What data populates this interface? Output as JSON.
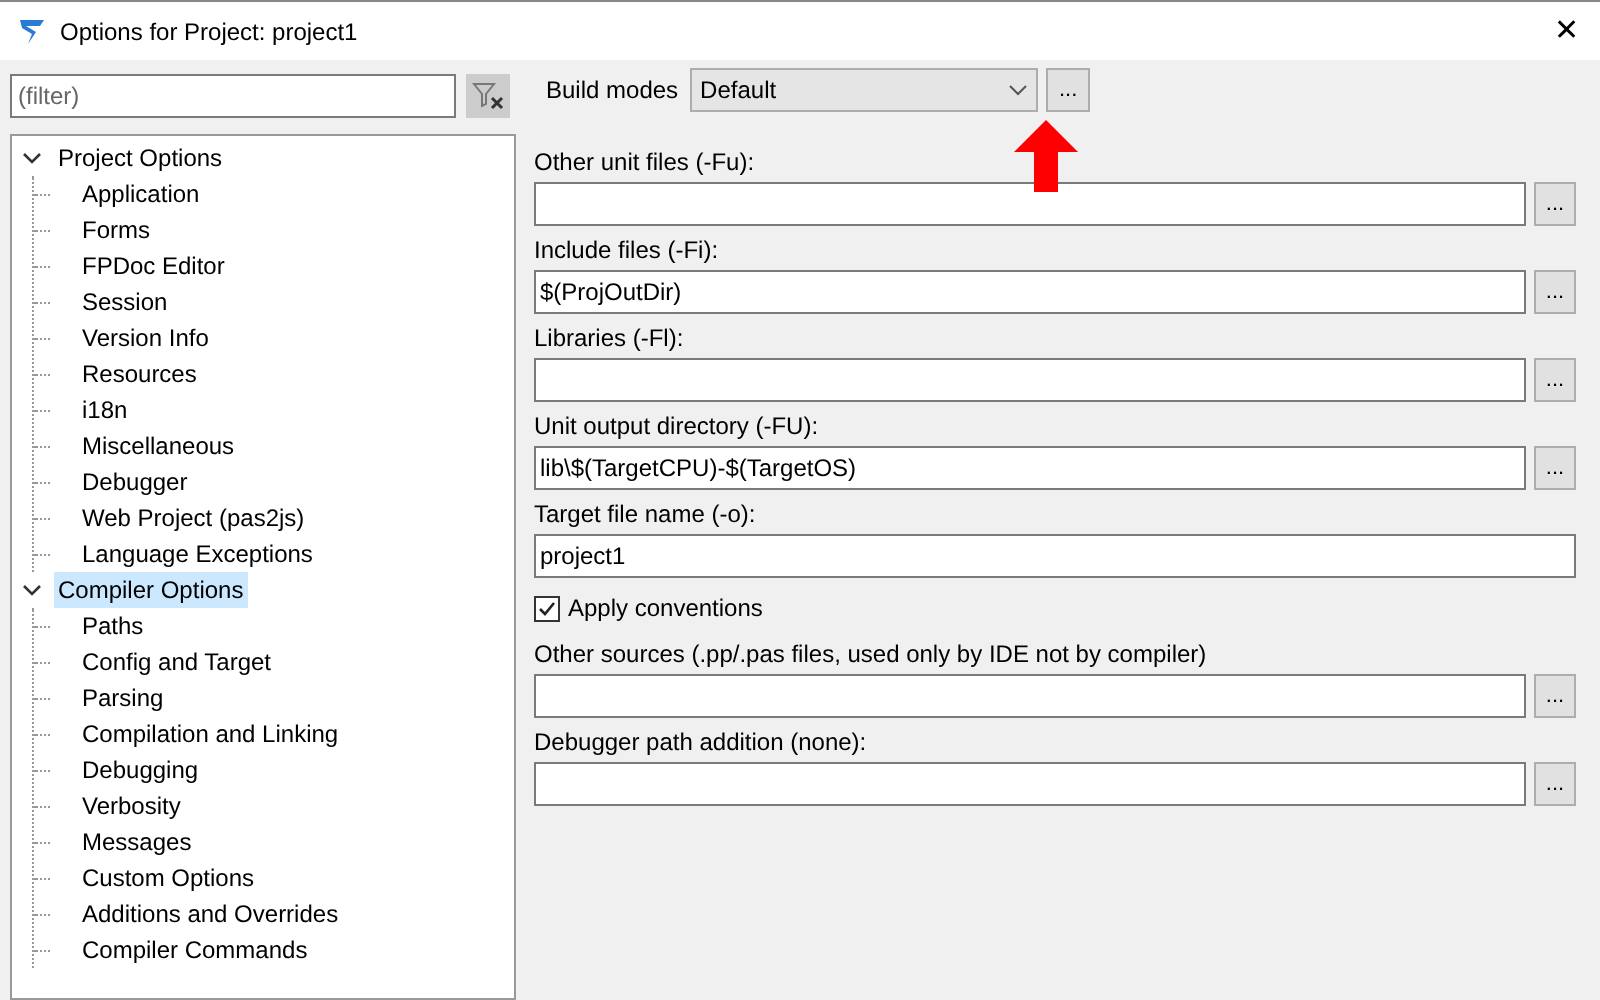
{
  "window": {
    "title": "Options for Project: project1",
    "close": "✕"
  },
  "filter": {
    "placeholder": "(filter)"
  },
  "tree": [
    {
      "label": "Project Options",
      "selected": false,
      "expanded": true,
      "children": [
        {
          "label": "Application",
          "selected": false
        },
        {
          "label": "Forms",
          "selected": false
        },
        {
          "label": "FPDoc Editor",
          "selected": false
        },
        {
          "label": "Session",
          "selected": false
        },
        {
          "label": "Version Info",
          "selected": false
        },
        {
          "label": "Resources",
          "selected": false
        },
        {
          "label": "i18n",
          "selected": false
        },
        {
          "label": "Miscellaneous",
          "selected": false
        },
        {
          "label": "Debugger",
          "selected": false
        },
        {
          "label": "Web Project (pas2js)",
          "selected": false
        },
        {
          "label": "Language Exceptions",
          "selected": false
        }
      ]
    },
    {
      "label": "Compiler Options",
      "selected": true,
      "expanded": true,
      "children": [
        {
          "label": "Paths",
          "selected": false
        },
        {
          "label": "Config and Target",
          "selected": false
        },
        {
          "label": "Parsing",
          "selected": false
        },
        {
          "label": "Compilation and Linking",
          "selected": false
        },
        {
          "label": "Debugging",
          "selected": false
        },
        {
          "label": "Verbosity",
          "selected": false
        },
        {
          "label": "Messages",
          "selected": false
        },
        {
          "label": "Custom Options",
          "selected": false
        },
        {
          "label": "Additions and Overrides",
          "selected": false
        },
        {
          "label": "Compiler Commands",
          "selected": false
        }
      ]
    }
  ],
  "build_modes": {
    "label": "Build modes",
    "value": "Default",
    "button": "..."
  },
  "fields": [
    {
      "kind": "path",
      "label": "Other unit files (-Fu):",
      "button": "..."
    },
    {
      "kind": "path",
      "label": "Include files (-Fi):",
      "value": "$(ProjOutDir)",
      "button": "..."
    },
    {
      "kind": "path",
      "label": "Libraries (-Fl):",
      "button": "..."
    },
    {
      "kind": "path",
      "label": "Unit output directory (-FU):",
      "value": "lib\\$(TargetCPU)-$(TargetOS)",
      "button": "..."
    },
    {
      "kind": "text",
      "label": "Target file name (-o):",
      "value": "project1"
    },
    {
      "kind": "checkbox",
      "label": "Apply conventions",
      "checked": true
    },
    {
      "kind": "path",
      "label": "Other sources (.pp/.pas files, used only by IDE not by compiler)",
      "button": "..."
    },
    {
      "kind": "path",
      "label": "Debugger path addition (none):",
      "button": "..."
    }
  ]
}
